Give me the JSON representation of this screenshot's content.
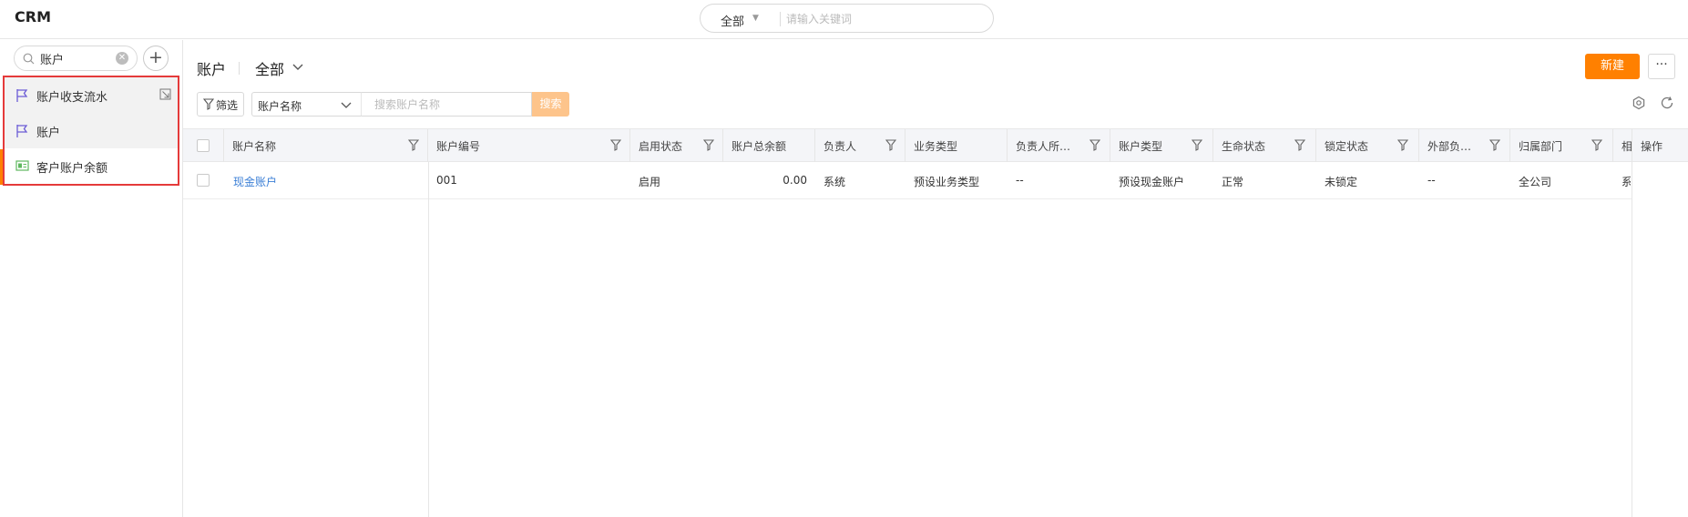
{
  "app": {
    "title": "CRM"
  },
  "global_search": {
    "scope": "全部",
    "placeholder": "请输入关键词"
  },
  "sidebar": {
    "search_value": "账户",
    "items": [
      {
        "label": "账户收支流水",
        "icon": "flag-icon"
      },
      {
        "label": "账户",
        "icon": "flag-icon"
      },
      {
        "label": "客户账户余额",
        "icon": "id-card-icon"
      }
    ]
  },
  "content": {
    "title": "账户",
    "view_filter": "全部",
    "new_button": "新建",
    "more_button": "···",
    "filter_button": "筛选",
    "search_field": "账户名称",
    "search_placeholder": "搜索账户名称",
    "search_button": "搜索"
  },
  "table": {
    "columns": [
      "账户名称",
      "账户编号",
      "启用状态",
      "账户总余额",
      "负责人",
      "业务类型",
      "负责人所…",
      "账户类型",
      "生命状态",
      "锁定状态",
      "外部负…",
      "归属部门",
      "相"
    ],
    "operation_header": "操作",
    "rows": [
      [
        "现金账户",
        "001",
        "启用",
        "0.00",
        "系统",
        "预设业务类型",
        "--",
        "预设现金账户",
        "正常",
        "未锁定",
        "--",
        "全公司",
        "系"
      ]
    ]
  },
  "colors": {
    "accent": "#ff8000",
    "link": "#3b7fd6",
    "highlight_border": "#e53a3a"
  }
}
